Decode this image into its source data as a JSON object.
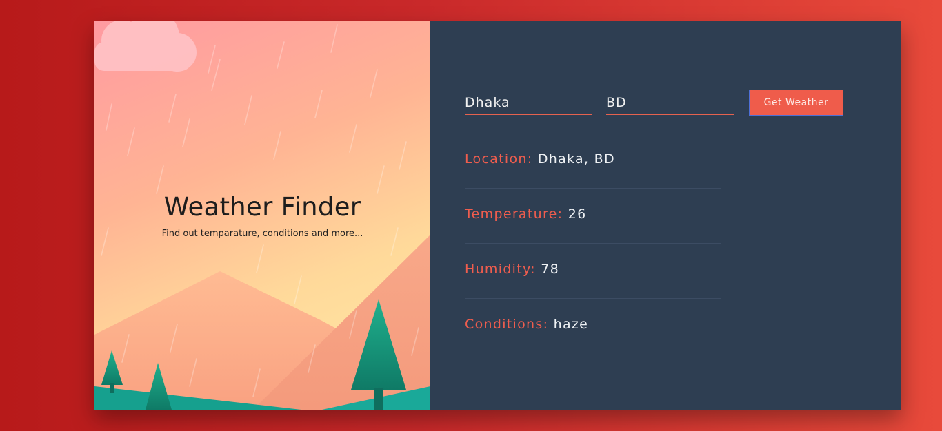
{
  "hero": {
    "title": "Weather Finder",
    "subtitle": "Find out temparature, conditions and more..."
  },
  "form": {
    "city_value": "Dhaka",
    "country_value": "BD",
    "submit_label": "Get Weather"
  },
  "results": {
    "location": {
      "label": "Location:",
      "value": "Dhaka, BD"
    },
    "temperature": {
      "label": "Temperature:",
      "value": "26"
    },
    "humidity": {
      "label": "Humidity:",
      "value": "78"
    },
    "conditions": {
      "label": "Conditions:",
      "value": "haze"
    }
  },
  "colors": {
    "page_bg": "#c62828",
    "panel_bg": "#2e3e52",
    "accent": "#ef5c4b",
    "value_text": "#eef1f4"
  }
}
